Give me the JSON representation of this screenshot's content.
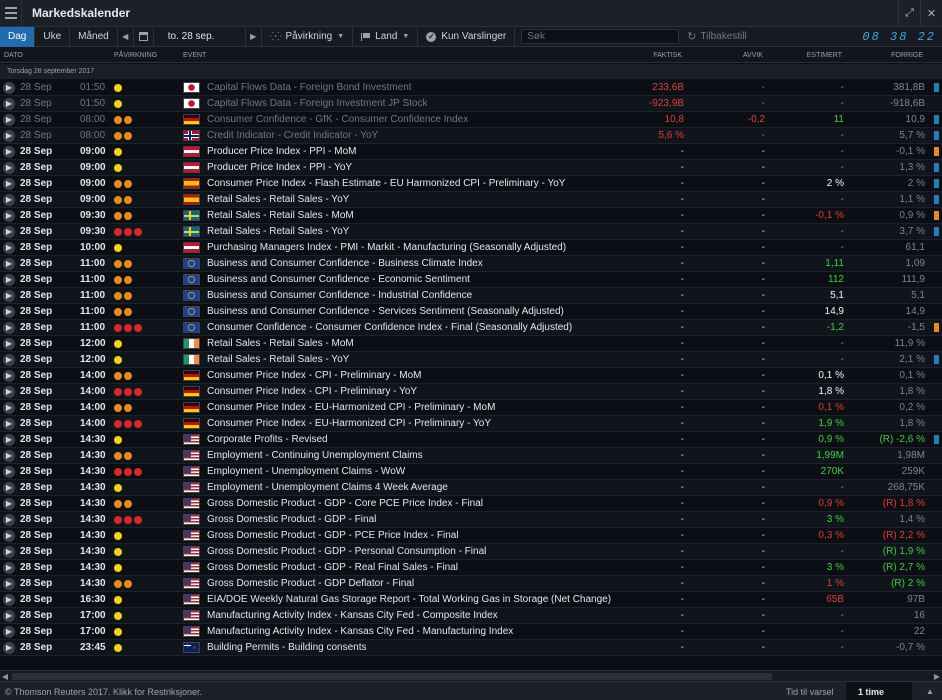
{
  "app": {
    "title": "Markedskalender",
    "clock": "08 38 22"
  },
  "toolbar": {
    "day": "Dag",
    "week": "Uke",
    "month": "Måned",
    "date": "to. 28 sep.",
    "impact": "Påvirkning",
    "country": "Land",
    "alerts_only": "Kun Varslinger",
    "search_placeholder": "Søk",
    "reset": "Tilbakestill"
  },
  "columns": {
    "date": "DATO",
    "impact": "PÅVIRKNING",
    "event": "EVENT",
    "actual": "FAKTISK",
    "deviation": "AVVIK",
    "estimated": "ESTIMERT",
    "previous": "FORRIGE"
  },
  "group_header": "Torsdag 28 september 2017",
  "impact_colors": {
    "low": "#f2d21b",
    "medium": "#e98a1e",
    "high": "#d92626"
  },
  "rows": [
    {
      "date": "28 Sep",
      "time": "01:50",
      "impact": 1,
      "flag": "jp",
      "event": "Capital Flows Data - Foreign Bond Investment",
      "actual": "233,6B",
      "actual_c": "red",
      "dev": "-",
      "est": "-",
      "est_c": "grey",
      "prev": "381,8B",
      "mark": "#1d7fc4",
      "past": true
    },
    {
      "date": "28 Sep",
      "time": "01:50",
      "impact": 1,
      "flag": "jp",
      "event": "Capital Flows Data - Foreign Investment JP Stock",
      "actual": "-923,9B",
      "actual_c": "red",
      "dev": "-",
      "est": "-",
      "est_c": "grey",
      "prev": "-918,6B",
      "mark": "",
      "past": true
    },
    {
      "date": "28 Sep",
      "time": "08:00",
      "impact": 2,
      "flag": "de",
      "event": "Consumer Confidence - GfK - Consumer Confidence Index",
      "actual": "10,8",
      "actual_c": "red",
      "dev": "-0,2",
      "dev_c": "red",
      "est": "11",
      "est_c": "green",
      "prev": "10,9",
      "mark": "#1d7fc4",
      "past": true
    },
    {
      "date": "28 Sep",
      "time": "08:00",
      "impact": 2,
      "flag": "no",
      "event": "Credit Indicator - Credit Indicator - YoY",
      "actual": "5,6 %",
      "actual_c": "red",
      "dev": "-",
      "est": "-",
      "est_c": "grey",
      "prev": "5,7 %",
      "mark": "#1d7fc4",
      "past": true
    },
    {
      "date": "28 Sep",
      "time": "09:00",
      "impact": 1,
      "flag": "at",
      "event": "Producer Price Index - PPI - MoM",
      "actual": "-",
      "dev": "-",
      "est": "-",
      "est_c": "grey",
      "prev": "-0,1 %",
      "mark": "#e98a1e"
    },
    {
      "date": "28 Sep",
      "time": "09:00",
      "impact": 1,
      "flag": "at",
      "event": "Producer Price Index - PPI - YoY",
      "actual": "-",
      "dev": "-",
      "est": "-",
      "est_c": "grey",
      "prev": "1,3 %",
      "mark": "#1d7fc4"
    },
    {
      "date": "28 Sep",
      "time": "09:00",
      "impact": 2,
      "flag": "es",
      "event": "Consumer Price Index - Flash Estimate - EU Harmonized CPI - Preliminary - YoY",
      "actual": "-",
      "dev": "-",
      "est": "2 %",
      "est_c": "white",
      "prev": "2 %",
      "mark": "#1d7fc4"
    },
    {
      "date": "28 Sep",
      "time": "09:00",
      "impact": 2,
      "flag": "es",
      "event": "Retail Sales - Retail Sales - YoY",
      "actual": "-",
      "dev": "-",
      "est": "-",
      "est_c": "grey",
      "prev": "1,1 %",
      "mark": "#1d7fc4"
    },
    {
      "date": "28 Sep",
      "time": "09:30",
      "impact": 2,
      "flag": "se",
      "event": "Retail Sales - Retail Sales - MoM",
      "actual": "-",
      "dev": "-",
      "est": "-0,1 %",
      "est_c": "red",
      "prev": "0,9 %",
      "mark": "#e98a1e"
    },
    {
      "date": "28 Sep",
      "time": "09:30",
      "impact": 3,
      "flag": "se",
      "event": "Retail Sales - Retail Sales - YoY",
      "actual": "-",
      "dev": "-",
      "est": "-",
      "est_c": "grey",
      "prev": "3,7 %",
      "mark": "#1d7fc4"
    },
    {
      "date": "28 Sep",
      "time": "10:00",
      "impact": 1,
      "flag": "at",
      "event": "Purchasing Managers Index - PMI - Markit - Manufacturing (Seasonally Adjusted)",
      "actual": "-",
      "dev": "-",
      "est": "-",
      "est_c": "grey",
      "prev": "61,1",
      "mark": ""
    },
    {
      "date": "28 Sep",
      "time": "11:00",
      "impact": 2,
      "flag": "eu",
      "event": "Business and Consumer Confidence - Business Climate Index",
      "actual": "-",
      "dev": "-",
      "est": "1,11",
      "est_c": "green",
      "prev": "1,09",
      "mark": ""
    },
    {
      "date": "28 Sep",
      "time": "11:00",
      "impact": 2,
      "flag": "eu",
      "event": "Business and Consumer Confidence - Economic Sentiment",
      "actual": "-",
      "dev": "-",
      "est": "112",
      "est_c": "green",
      "prev": "111,9",
      "mark": ""
    },
    {
      "date": "28 Sep",
      "time": "11:00",
      "impact": 2,
      "flag": "eu",
      "event": "Business and Consumer Confidence - Industrial Confidence",
      "actual": "-",
      "dev": "-",
      "est": "5,1",
      "est_c": "white",
      "prev": "5,1",
      "mark": ""
    },
    {
      "date": "28 Sep",
      "time": "11:00",
      "impact": 2,
      "flag": "eu",
      "event": "Business and Consumer Confidence - Services Sentiment (Seasonally Adjusted)",
      "actual": "-",
      "dev": "-",
      "est": "14,9",
      "est_c": "white",
      "prev": "14,9",
      "mark": ""
    },
    {
      "date": "28 Sep",
      "time": "11:00",
      "impact": 3,
      "flag": "eu",
      "event": "Consumer Confidence - Consumer Confidence Index - Final (Seasonally Adjusted)",
      "actual": "-",
      "dev": "-",
      "est": "-1,2",
      "est_c": "green",
      "prev": "-1,5",
      "mark": "#e98a1e"
    },
    {
      "date": "28 Sep",
      "time": "12:00",
      "impact": 1,
      "flag": "ie",
      "event": "Retail Sales - Retail Sales - MoM",
      "actual": "-",
      "dev": "-",
      "est": "-",
      "est_c": "grey",
      "prev": "11,9 %",
      "mark": ""
    },
    {
      "date": "28 Sep",
      "time": "12:00",
      "impact": 1,
      "flag": "ie",
      "event": "Retail Sales - Retail Sales - YoY",
      "actual": "-",
      "dev": "-",
      "est": "-",
      "est_c": "grey",
      "prev": "2,1 %",
      "mark": "#1d7fc4"
    },
    {
      "date": "28 Sep",
      "time": "14:00",
      "impact": 2,
      "flag": "de",
      "event": "Consumer Price Index - CPI - Preliminary - MoM",
      "actual": "-",
      "dev": "-",
      "est": "0,1 %",
      "est_c": "white",
      "prev": "0,1 %",
      "mark": ""
    },
    {
      "date": "28 Sep",
      "time": "14:00",
      "impact": 3,
      "flag": "de",
      "event": "Consumer Price Index - CPI - Preliminary - YoY",
      "actual": "-",
      "dev": "-",
      "est": "1,8 %",
      "est_c": "white",
      "prev": "1,8 %",
      "mark": ""
    },
    {
      "date": "28 Sep",
      "time": "14:00",
      "impact": 2,
      "flag": "de",
      "event": "Consumer Price Index - EU-Harmonized CPI - Preliminary - MoM",
      "actual": "-",
      "dev": "-",
      "est": "0,1 %",
      "est_c": "red",
      "prev": "0,2 %",
      "mark": ""
    },
    {
      "date": "28 Sep",
      "time": "14:00",
      "impact": 3,
      "flag": "de",
      "event": "Consumer Price Index - EU-Harmonized CPI - Preliminary - YoY",
      "actual": "-",
      "dev": "-",
      "est": "1,9 %",
      "est_c": "green",
      "prev": "1,8 %",
      "mark": ""
    },
    {
      "date": "28 Sep",
      "time": "14:30",
      "impact": 1,
      "flag": "us",
      "event": "Corporate Profits - Revised",
      "actual": "-",
      "dev": "-",
      "est": "0,9 %",
      "est_c": "green",
      "prev": "(R) -2,6 %",
      "prev_c": "green",
      "mark": "#1d7fc4"
    },
    {
      "date": "28 Sep",
      "time": "14:30",
      "impact": 2,
      "flag": "us",
      "event": "Employment - Continuing Unemployment Claims",
      "actual": "-",
      "dev": "-",
      "est": "1,99M",
      "est_c": "green",
      "prev": "1,98M",
      "mark": ""
    },
    {
      "date": "28 Sep",
      "time": "14:30",
      "impact": 3,
      "flag": "us",
      "event": "Employment - Unemployment Claims - WoW",
      "actual": "-",
      "dev": "-",
      "est": "270K",
      "est_c": "green",
      "prev": "259K",
      "mark": ""
    },
    {
      "date": "28 Sep",
      "time": "14:30",
      "impact": 1,
      "flag": "us",
      "event": "Employment - Unemployment Claims 4 Week Average",
      "actual": "-",
      "dev": "-",
      "est": "-",
      "est_c": "grey",
      "prev": "268,75K",
      "mark": ""
    },
    {
      "date": "28 Sep",
      "time": "14:30",
      "impact": 2,
      "flag": "us",
      "event": "Gross Domestic Product - GDP - Core PCE Price Index - Final",
      "actual": "-",
      "dev": "-",
      "est": "0,9 %",
      "est_c": "red",
      "prev": "(R) 1,8 %",
      "prev_c": "red",
      "mark": ""
    },
    {
      "date": "28 Sep",
      "time": "14:30",
      "impact": 3,
      "flag": "us",
      "event": "Gross Domestic Product - GDP - Final",
      "actual": "-",
      "dev": "-",
      "est": "3 %",
      "est_c": "green",
      "prev": "1,4 %",
      "mark": ""
    },
    {
      "date": "28 Sep",
      "time": "14:30",
      "impact": 1,
      "flag": "us",
      "event": "Gross Domestic Product - GDP - PCE Price Index - Final",
      "actual": "-",
      "dev": "-",
      "est": "0,3 %",
      "est_c": "red",
      "prev": "(R) 2,2 %",
      "prev_c": "red",
      "mark": ""
    },
    {
      "date": "28 Sep",
      "time": "14:30",
      "impact": 1,
      "flag": "us",
      "event": "Gross Domestic Product - GDP - Personal Consumption - Final",
      "actual": "-",
      "dev": "-",
      "est": "-",
      "est_c": "grey",
      "prev": "(R) 1,9 %",
      "prev_c": "green",
      "mark": ""
    },
    {
      "date": "28 Sep",
      "time": "14:30",
      "impact": 1,
      "flag": "us",
      "event": "Gross Domestic Product - GDP - Real Final Sales - Final",
      "actual": "-",
      "dev": "-",
      "est": "3 %",
      "est_c": "green",
      "prev": "(R) 2,7 %",
      "prev_c": "green",
      "mark": ""
    },
    {
      "date": "28 Sep",
      "time": "14:30",
      "impact": 2,
      "flag": "us",
      "event": "Gross Domestic Product - GDP Deflator - Final",
      "actual": "-",
      "dev": "-",
      "est": "1 %",
      "est_c": "red",
      "prev": "(R) 2 %",
      "prev_c": "green",
      "mark": ""
    },
    {
      "date": "28 Sep",
      "time": "16:30",
      "impact": 1,
      "flag": "us",
      "event": "EIA/DOE Weekly Natural Gas Storage Report - Total Working Gas in Storage (Net Change)",
      "actual": "-",
      "dev": "-",
      "est": "65B",
      "est_c": "red",
      "prev": "97B",
      "mark": ""
    },
    {
      "date": "28 Sep",
      "time": "17:00",
      "impact": 1,
      "flag": "us",
      "event": "Manufacturing Activity Index - Kansas City Fed - Composite Index",
      "actual": "-",
      "dev": "-",
      "est": "-",
      "est_c": "grey",
      "prev": "16",
      "mark": ""
    },
    {
      "date": "28 Sep",
      "time": "17:00",
      "impact": 1,
      "flag": "us",
      "event": "Manufacturing Activity Index - Kansas City Fed - Manufacturing Index",
      "actual": "-",
      "dev": "-",
      "est": "-",
      "est_c": "grey",
      "prev": "22",
      "mark": ""
    },
    {
      "date": "28 Sep",
      "time": "23:45",
      "impact": 1,
      "flag": "nz",
      "event": "Building Permits - Building consents",
      "actual": "-",
      "dev": "-",
      "est": "-",
      "est_c": "grey",
      "prev": "-0,7 %",
      "mark": ""
    }
  ],
  "status": {
    "copyright": "© Thomson Reuters 2017. Klikk for Restriksjoner.",
    "time_to_alert_label": "Tid til varsel",
    "time_to_alert_value": "1 time"
  }
}
